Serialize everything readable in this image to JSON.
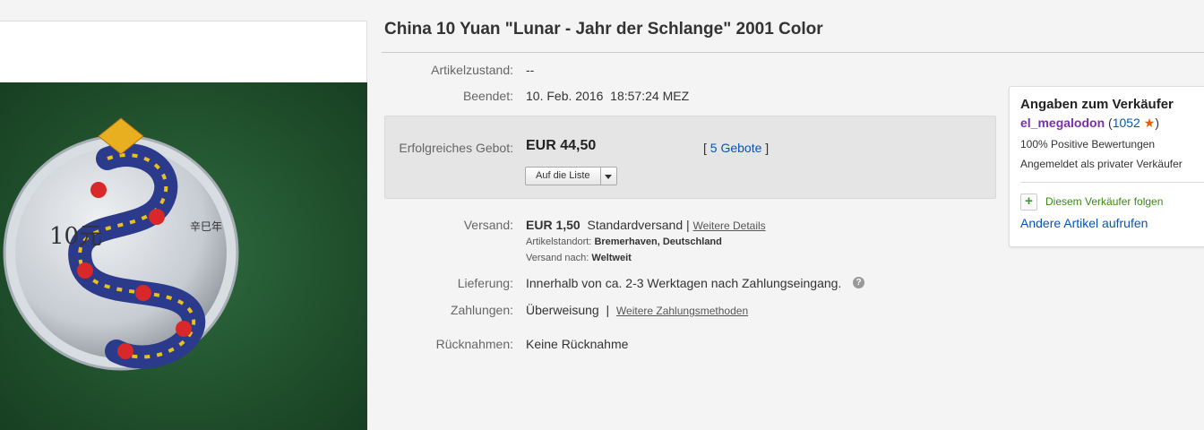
{
  "title": "China 10 Yuan \"Lunar - Jahr der Schlange\" 2001 Color",
  "details": {
    "condition": {
      "label": "Artikelzustand:",
      "value": "--"
    },
    "ended": {
      "label": "Beendet:",
      "value": "10. Feb. 2016  18:57:24 MEZ"
    }
  },
  "bid": {
    "label": "Erfolgreiches Gebot:",
    "price": "EUR 44,50",
    "bids_open": "[",
    "bids_link": "5 Gebote",
    "bids_close": "]",
    "watch_label": "Auf die Liste"
  },
  "shipping": {
    "label": "Versand:",
    "price": "EUR 1,50",
    "method": "Standardversand |",
    "details_link": "Weitere Details",
    "location_label": "Artikelstandort:",
    "location": "Bremerhaven, Deutschland",
    "ships_to_label": "Versand nach:",
    "ships_to": "Weltweit"
  },
  "delivery": {
    "label": "Lieferung:",
    "value": "Innerhalb von ca. 2-3 Werktagen nach Zahlungseingang."
  },
  "payment": {
    "label": "Zahlungen:",
    "value": "Überweisung",
    "sep": "|",
    "link": "Weitere Zahlungsmethoden"
  },
  "returns": {
    "label": "Rücknahmen:",
    "value": "Keine Rücknahme"
  },
  "seller": {
    "title": "Angaben zum Verkäufer",
    "name": "el_megalodon",
    "score_open": "(",
    "score": "1052",
    "score_close": ")",
    "positive": "100% Positive Bewertungen",
    "type": "Angemeldet als privater Verkäufer",
    "follow": "Diesem Verkäufer folgen",
    "other_items": "Andere Artikel aufrufen"
  },
  "coin": {
    "denomination": "10元",
    "side_text": "辛巳年"
  },
  "colors": {
    "link": "#0654ba",
    "seller_name": "#7b2fa8",
    "star": "#e65c00",
    "follow": "#3a8a10"
  }
}
